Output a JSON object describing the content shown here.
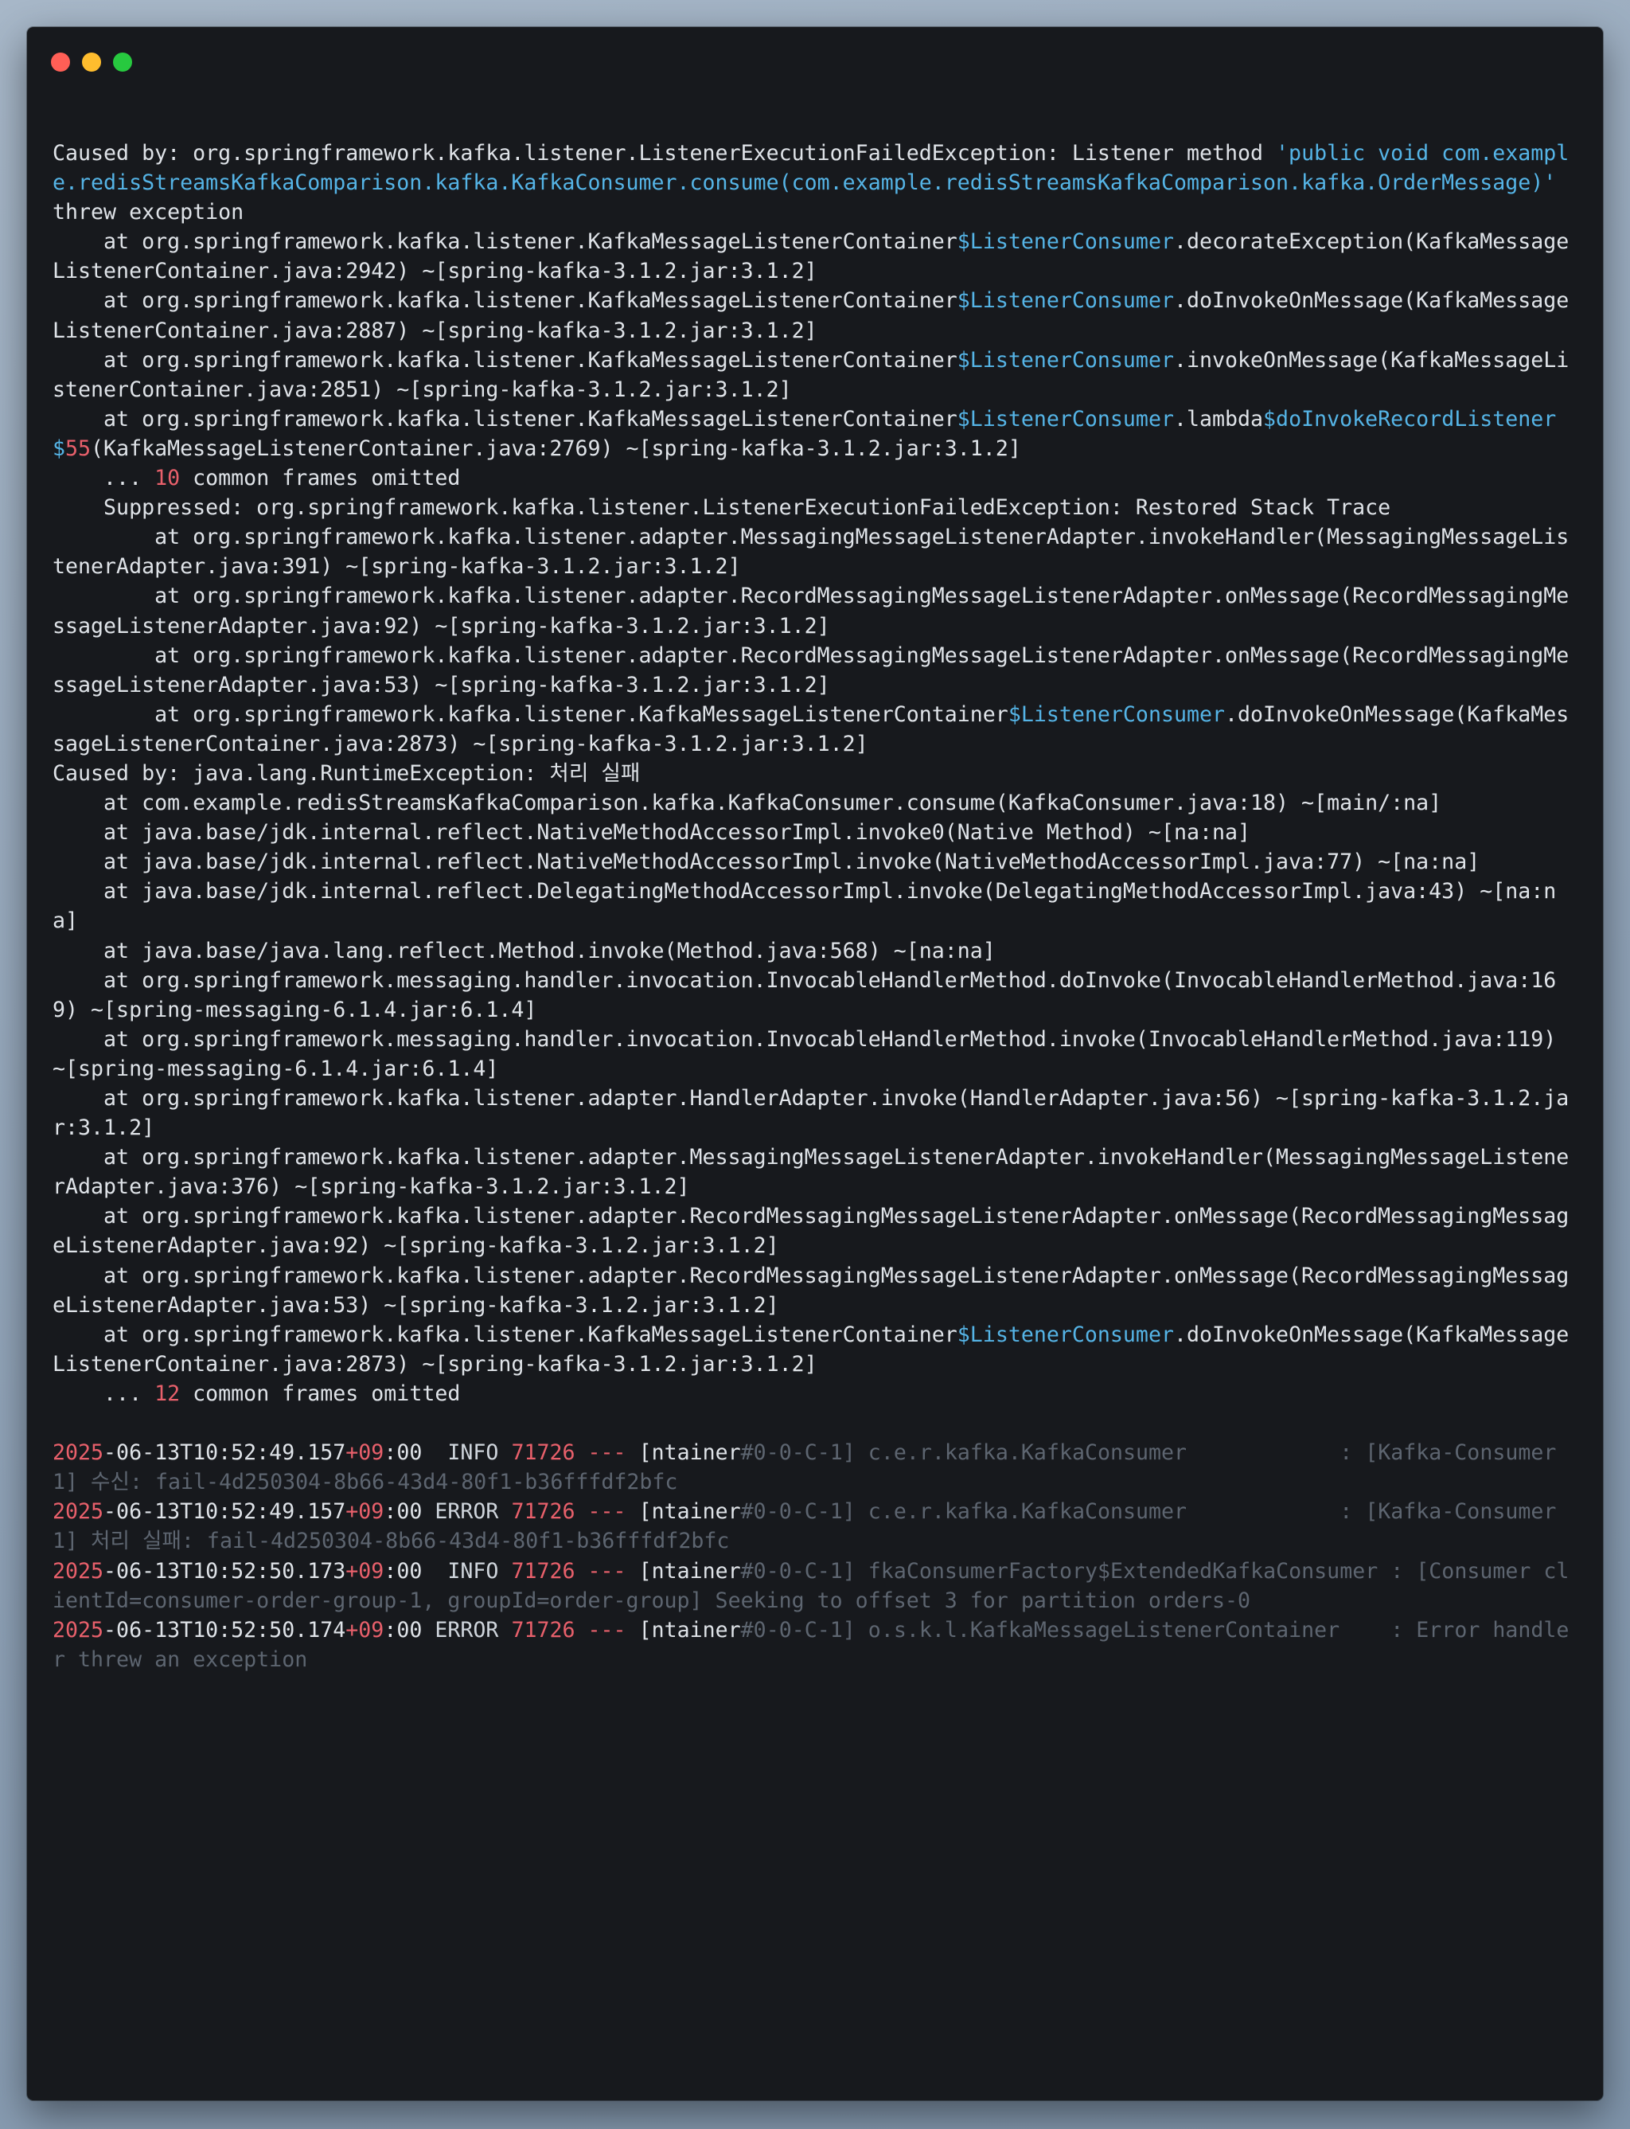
{
  "window": {
    "traffic_lights": [
      "close",
      "minimize",
      "maximize"
    ],
    "colors": {
      "background": "#17191d",
      "text": "#dfe3e8",
      "accent": "#55b4e6",
      "number": "#e8606b",
      "dim": "#5d6570"
    }
  },
  "trace": [
    [
      {
        "t": "Caused by: org.springframework.kafka.listener.ListenerExecutionFailedException: Listener method "
      },
      {
        "t": "'public void com.example.redisStreamsKafkaComparison.kafka.KafkaConsumer.consume(com.example.redisStreamsKafkaComparison.kafka.OrderMessage)'",
        "c": "cls"
      },
      {
        "t": " threw exception"
      }
    ],
    [
      {
        "t": "    at org.springframework.kafka.listener.KafkaMessageListenerContainer"
      },
      {
        "t": "$ListenerConsumer",
        "c": "cls"
      },
      {
        "t": ".decorateException(KafkaMessageListenerContainer.java:2942) ~[spring-kafka-3.1.2.jar:3.1.2]"
      }
    ],
    [
      {
        "t": "    at org.springframework.kafka.listener.KafkaMessageListenerContainer"
      },
      {
        "t": "$ListenerConsumer",
        "c": "cls"
      },
      {
        "t": ".doInvokeOnMessage(KafkaMessageListenerContainer.java:2887) ~[spring-kafka-3.1.2.jar:3.1.2]"
      }
    ],
    [
      {
        "t": "    at org.springframework.kafka.listener.KafkaMessageListenerContainer"
      },
      {
        "t": "$ListenerConsumer",
        "c": "cls"
      },
      {
        "t": ".invokeOnMessage(KafkaMessageListenerContainer.java:2851) ~[spring-kafka-3.1.2.jar:3.1.2]"
      }
    ],
    [
      {
        "t": "    at org.springframework.kafka.listener.KafkaMessageListenerContainer"
      },
      {
        "t": "$ListenerConsumer",
        "c": "cls"
      },
      {
        "t": ".lambda"
      },
      {
        "t": "$doInvokeRecordListener$",
        "c": "cls"
      },
      {
        "t": "55",
        "c": "num"
      },
      {
        "t": "(KafkaMessageListenerContainer.java:2769) ~[spring-kafka-3.1.2.jar:3.1.2]"
      }
    ],
    [
      {
        "t": "    ... "
      },
      {
        "t": "10",
        "c": "num"
      },
      {
        "t": " common frames omitted"
      }
    ],
    [
      {
        "t": "    Suppressed: org.springframework.kafka.listener.ListenerExecutionFailedException: Restored Stack Trace"
      }
    ],
    [
      {
        "t": "        at org.springframework.kafka.listener.adapter.MessagingMessageListenerAdapter.invokeHandler(MessagingMessageListenerAdapter.java:391) ~[spring-kafka-3.1.2.jar:3.1.2]"
      }
    ],
    [
      {
        "t": "        at org.springframework.kafka.listener.adapter.RecordMessagingMessageListenerAdapter.onMessage(RecordMessagingMessageListenerAdapter.java:92) ~[spring-kafka-3.1.2.jar:3.1.2]"
      }
    ],
    [
      {
        "t": "        at org.springframework.kafka.listener.adapter.RecordMessagingMessageListenerAdapter.onMessage(RecordMessagingMessageListenerAdapter.java:53) ~[spring-kafka-3.1.2.jar:3.1.2]"
      }
    ],
    [
      {
        "t": "        at org.springframework.kafka.listener.KafkaMessageListenerContainer"
      },
      {
        "t": "$ListenerConsumer",
        "c": "cls"
      },
      {
        "t": ".doInvokeOnMessage(KafkaMessageListenerContainer.java:2873) ~[spring-kafka-3.1.2.jar:3.1.2]"
      }
    ],
    [
      {
        "t": "Caused by: java.lang.RuntimeException: 처리 실패"
      }
    ],
    [
      {
        "t": "    at com.example.redisStreamsKafkaComparison.kafka.KafkaConsumer.consume(KafkaConsumer.java:18) ~[main/:na]"
      }
    ],
    [
      {
        "t": "    at java.base/jdk.internal.reflect.NativeMethodAccessorImpl.invoke0(Native Method) ~[na:na]"
      }
    ],
    [
      {
        "t": "    at java.base/jdk.internal.reflect.NativeMethodAccessorImpl.invoke(NativeMethodAccessorImpl.java:77) ~[na:na]"
      }
    ],
    [
      {
        "t": "    at java.base/jdk.internal.reflect.DelegatingMethodAccessorImpl.invoke(DelegatingMethodAccessorImpl.java:43) ~[na:na]"
      }
    ],
    [
      {
        "t": "    at java.base/java.lang.reflect.Method.invoke(Method.java:568) ~[na:na]"
      }
    ],
    [
      {
        "t": "    at org.springframework.messaging.handler.invocation.InvocableHandlerMethod.doInvoke(InvocableHandlerMethod.java:169) ~[spring-messaging-6.1.4.jar:6.1.4]"
      }
    ],
    [
      {
        "t": "    at org.springframework.messaging.handler.invocation.InvocableHandlerMethod.invoke(InvocableHandlerMethod.java:119) ~[spring-messaging-6.1.4.jar:6.1.4]"
      }
    ],
    [
      {
        "t": "    at org.springframework.kafka.listener.adapter.HandlerAdapter.invoke(HandlerAdapter.java:56) ~[spring-kafka-3.1.2.jar:3.1.2]"
      }
    ],
    [
      {
        "t": "    at org.springframework.kafka.listener.adapter.MessagingMessageListenerAdapter.invokeHandler(MessagingMessageListenerAdapter.java:376) ~[spring-kafka-3.1.2.jar:3.1.2]"
      }
    ],
    [
      {
        "t": "    at org.springframework.kafka.listener.adapter.RecordMessagingMessageListenerAdapter.onMessage(RecordMessagingMessageListenerAdapter.java:92) ~[spring-kafka-3.1.2.jar:3.1.2]"
      }
    ],
    [
      {
        "t": "    at org.springframework.kafka.listener.adapter.RecordMessagingMessageListenerAdapter.onMessage(RecordMessagingMessageListenerAdapter.java:53) ~[spring-kafka-3.1.2.jar:3.1.2]"
      }
    ],
    [
      {
        "t": "    at org.springframework.kafka.listener.KafkaMessageListenerContainer"
      },
      {
        "t": "$ListenerConsumer",
        "c": "cls"
      },
      {
        "t": ".doInvokeOnMessage(KafkaMessageListenerContainer.java:2873) ~[spring-kafka-3.1.2.jar:3.1.2]"
      }
    ],
    [
      {
        "t": "    ... "
      },
      {
        "t": "12",
        "c": "num"
      },
      {
        "t": " common frames omitted"
      }
    ]
  ],
  "logs": [
    {
      "date": "2025",
      "rest": "-06-13T10:52:49.157",
      "tz": "+",
      "tzv": "09",
      "tzr": ":00",
      "level": "  INFO",
      "pid": "71726",
      "sep": " --- ",
      "thread_a": "[ntainer",
      "thread_b": "#0-0-C-1]",
      "logger": " c.e.r.kafka.KafkaConsumer",
      "colon": "            : ",
      "msg": "[Kafka-Consumer1] 수신: fail-4d250304-8b66-43d4-80f1-b36fffdf2bfc"
    },
    {
      "date": "2025",
      "rest": "-06-13T10:52:49.157",
      "tz": "+",
      "tzv": "09",
      "tzr": ":00",
      "level": " ERROR",
      "pid": "71726",
      "sep": " --- ",
      "thread_a": "[ntainer",
      "thread_b": "#0-0-C-1]",
      "logger": " c.e.r.kafka.KafkaConsumer",
      "colon": "            : ",
      "msg": "[Kafka-Consumer1] 처리 실패: fail-4d250304-8b66-43d4-80f1-b36fffdf2bfc"
    },
    {
      "date": "2025",
      "rest": "-06-13T10:52:50.173",
      "tz": "+",
      "tzv": "09",
      "tzr": ":00",
      "level": "  INFO",
      "pid": "71726",
      "sep": " --- ",
      "thread_a": "[ntainer",
      "thread_b": "#0-0-C-1]",
      "logger": " fkaConsumerFactory$ExtendedKafkaConsumer",
      "colon": " : ",
      "msg": "[Consumer clientId=consumer-order-group-1, groupId=order-group] Seeking to offset 3 for partition orders-0"
    },
    {
      "date": "2025",
      "rest": "-06-13T10:52:50.174",
      "tz": "+",
      "tzv": "09",
      "tzr": ":00",
      "level": " ERROR",
      "pid": "71726",
      "sep": " --- ",
      "thread_a": "[ntainer",
      "thread_b": "#0-0-C-1]",
      "logger": " o.s.k.l.KafkaMessageListenerContainer",
      "colon": "    : ",
      "msg": "Error handler threw an exception"
    }
  ]
}
